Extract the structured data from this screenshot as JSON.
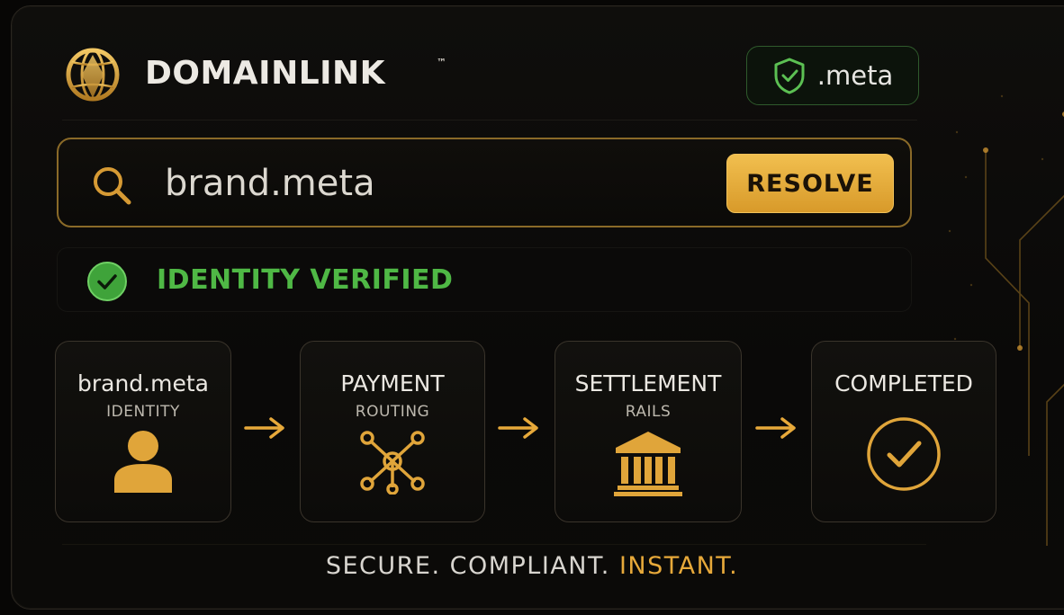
{
  "header": {
    "brand_name": "DOMAINLINK",
    "trademark": "™",
    "logo_icon": "globe-icon",
    "tld_badge": {
      "icon": "shield-check-icon",
      "label": ".meta"
    }
  },
  "search": {
    "icon": "search-icon",
    "value": "brand.meta",
    "button_label": "RESOLVE"
  },
  "status": {
    "icon": "check-circle-icon",
    "text": "IDENTITY VERIFIED",
    "color": "#4fb845"
  },
  "flow": {
    "steps": [
      {
        "title": "brand.meta",
        "subtitle": "IDENTITY",
        "icon": "user-icon"
      },
      {
        "title": "PAYMENT",
        "subtitle": "ROUTING",
        "icon": "network-icon"
      },
      {
        "title": "SETTLEMENT",
        "subtitle": "RAILS",
        "icon": "bank-icon"
      },
      {
        "title": "COMPLETED",
        "subtitle": "",
        "icon": "check-circle-icon"
      }
    ],
    "arrow_icon": "arrow-right-icon"
  },
  "tagline": {
    "part1": "SECURE. COMPLIANT. ",
    "part2": "INSTANT."
  },
  "colors": {
    "accent": "#e7a93a",
    "success": "#4fb845",
    "background": "#070605"
  }
}
